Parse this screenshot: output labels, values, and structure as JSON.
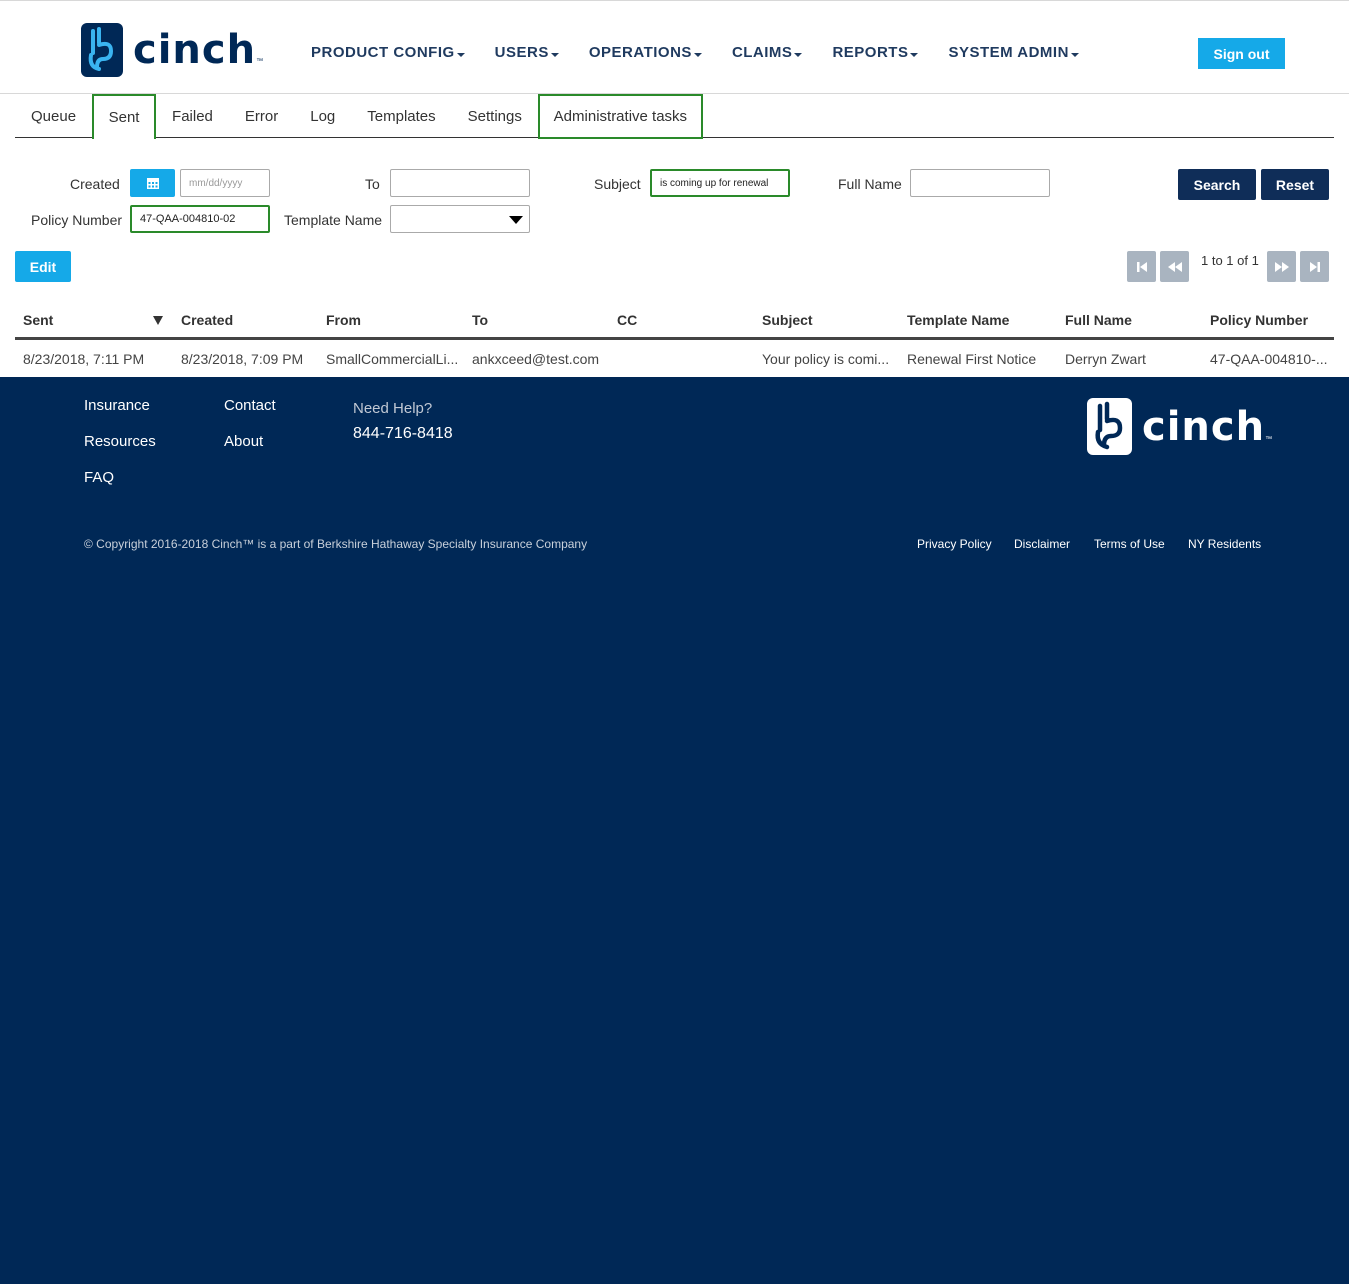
{
  "brand": {
    "name": "cinch",
    "tm": "™"
  },
  "nav": [
    {
      "label": "PRODUCT CONFIG"
    },
    {
      "label": "USERS"
    },
    {
      "label": "OPERATIONS"
    },
    {
      "label": "CLAIMS"
    },
    {
      "label": "REPORTS"
    },
    {
      "label": "SYSTEM ADMIN"
    }
  ],
  "signout_label": "Sign out",
  "tabs": [
    {
      "label": "Queue"
    },
    {
      "label": "Sent",
      "active": true
    },
    {
      "label": "Failed"
    },
    {
      "label": "Error"
    },
    {
      "label": "Log"
    },
    {
      "label": "Templates"
    },
    {
      "label": "Settings"
    },
    {
      "label": "Administrative tasks"
    }
  ],
  "filters": {
    "created_label": "Created",
    "created_placeholder": "mm/dd/yyyy",
    "to_label": "To",
    "to_value": "",
    "subject_label": "Subject",
    "subject_value": "is coming up for renewal",
    "full_name_label": "Full Name",
    "full_name_value": "",
    "policy_number_label": "Policy Number",
    "policy_number_value": "47-QAA-004810-02",
    "template_name_label": "Template Name",
    "template_name_value": "",
    "search_label": "Search",
    "reset_label": "Reset"
  },
  "edit_label": "Edit",
  "pager": {
    "text": "1 to 1 of 1"
  },
  "table": {
    "columns": [
      "Sent",
      "Created",
      "From",
      "To",
      "CC",
      "Subject",
      "Template Name",
      "Full Name",
      "Policy Number"
    ],
    "rows": [
      [
        "8/23/2018, 7:11 PM",
        "8/23/2018, 7:09 PM",
        "SmallCommercialLi...",
        "ankxceed@test.com",
        "",
        "Your policy is comi...",
        "Renewal First Notice",
        "Derryn Zwart",
        "47-QAA-004810-..."
      ]
    ]
  },
  "footer": {
    "links_col1": [
      "Insurance",
      "Resources",
      "FAQ"
    ],
    "links_col2": [
      "Contact",
      "About"
    ],
    "help_label": "Need Help?",
    "phone": "844-716-8418",
    "copyright": "© Copyright 2016-2018 Cinch™ is a part of Berkshire Hathaway Specialty Insurance Company",
    "legal": [
      "Privacy Policy",
      "Disclaimer",
      "Terms of Use",
      "NY Residents"
    ]
  },
  "colors": {
    "navy": "#002856",
    "accent": "#15a9e8",
    "button_dark": "#0f2d58",
    "active_border": "#2a8a2a"
  }
}
